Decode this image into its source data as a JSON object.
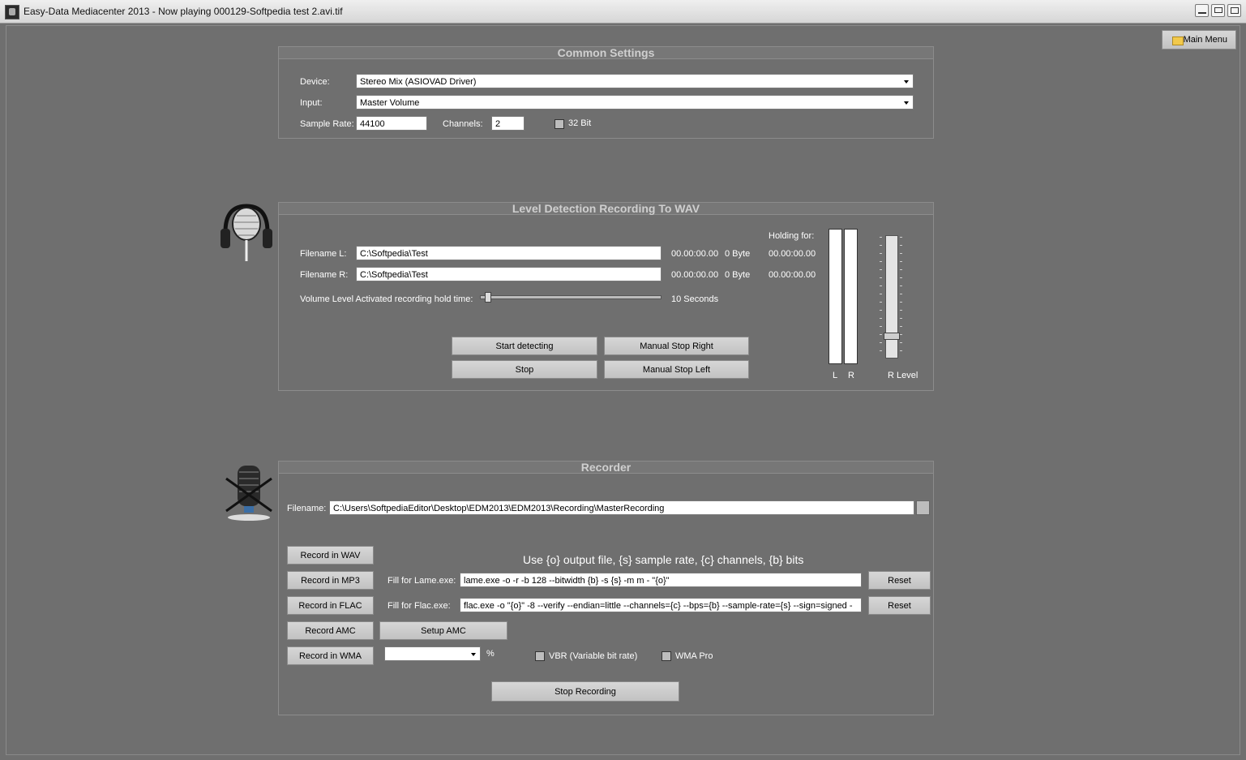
{
  "window": {
    "title": "Easy-Data Mediacenter 2013 - Now playing 000129-Softpedia test 2.avi.tif"
  },
  "main_menu_label": "Main Menu",
  "common": {
    "title": "Common Settings",
    "device_label": "Device:",
    "device_value": "Stereo Mix (ASIOVAD Driver)",
    "input_label": "Input:",
    "input_value": "Master Volume",
    "sample_rate_label": "Sample Rate:",
    "sample_rate_value": "44100",
    "channels_label": "Channels:",
    "channels_value": "2",
    "bit32_label": "32 Bit"
  },
  "level": {
    "title": "Level Detection Recording To WAV",
    "holding_label": "Holding for:",
    "file_l_label": "Filename L:",
    "file_l_value": "C:\\Softpedia\\Test",
    "file_r_label": "Filename R:",
    "file_r_value": "C:\\Softpedia\\Test",
    "l_time": "00.00:00.00",
    "l_size": "0 Byte",
    "l_hold": "00.00:00.00",
    "r_time": "00.00:00.00",
    "r_size": "0 Byte",
    "r_hold": "00.00:00.00",
    "hold_label": "Volume Level Activated recording hold time:",
    "hold_value": "10 Seconds",
    "start_label": "Start detecting",
    "stop_right_label": "Manual Stop Right",
    "stop_label": "Stop",
    "stop_left_label": "Manual Stop Left",
    "meter_l": "L",
    "meter_r": "R",
    "r_level_label": "R Level"
  },
  "recorder": {
    "title": "Recorder",
    "filename_label": "Filename:",
    "filename_value": "C:\\Users\\SoftpediaEditor\\Desktop\\EDM2013\\EDM2013\\Recording\\MasterRecording",
    "hint": "Use {o} output file, {s} sample rate, {c} channels, {b} bits",
    "wav_label": "Record in WAV",
    "mp3_label": "Record in MP3",
    "flac_label": "Record in FLAC",
    "amc_label": "Record AMC",
    "wma_label": "Record in WMA",
    "lame_label": "Fill for Lame.exe:",
    "lame_value": "lame.exe -o -r -b 128 --bitwidth {b} -s {s} -m m - \"{o}\"",
    "flac_fill_label": "Fill for Flac.exe:",
    "flac_value": "flac.exe -o \"{o}\" -8 --verify --endian=little --channels={c} --bps={b} --sample-rate={s} --sign=signed -",
    "reset_label": "Reset",
    "setup_amc_label": "Setup AMC",
    "percent": "%",
    "vbr_label": "VBR (Variable bit rate)",
    "wma_pro_label": "WMA Pro",
    "stop_recording_label": "Stop Recording"
  }
}
